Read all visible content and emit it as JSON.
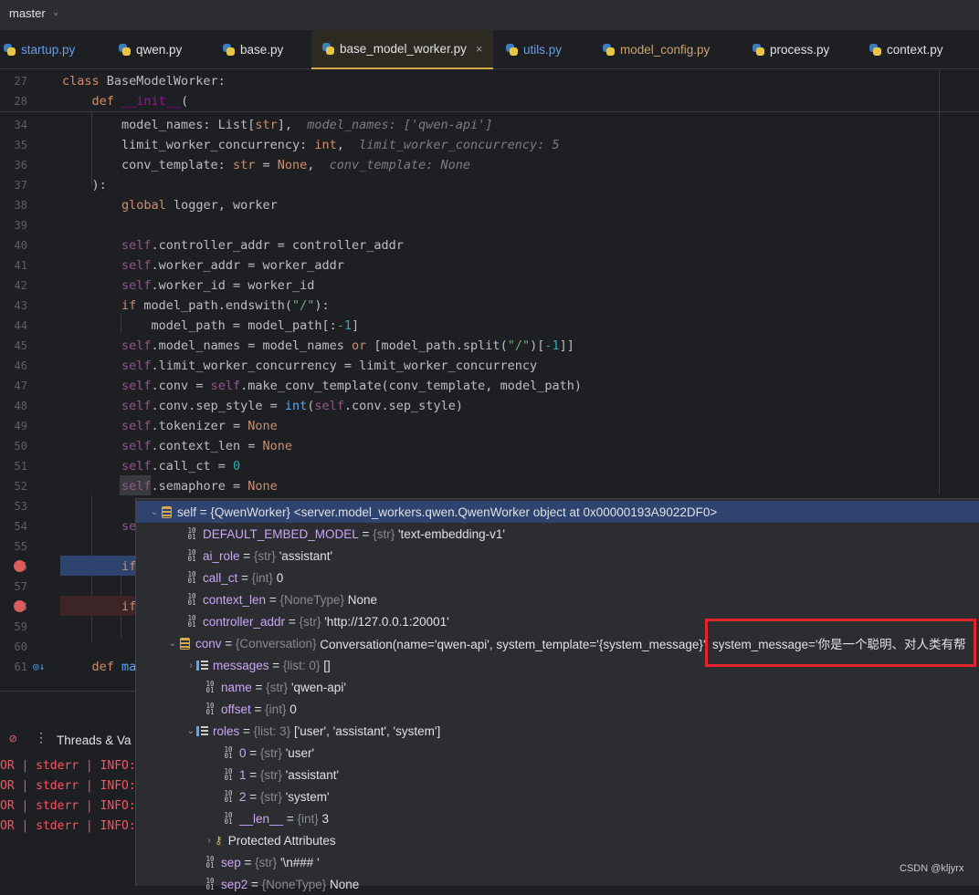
{
  "topbar": {
    "branch": "master"
  },
  "tabs": [
    {
      "label": "startup.py",
      "style": "blue"
    },
    {
      "label": "qwen.py",
      "style": "plain"
    },
    {
      "label": "base.py",
      "style": "plain"
    },
    {
      "label": "base_model_worker.py",
      "style": "active",
      "close": "×"
    },
    {
      "label": "utils.py",
      "style": "blue"
    },
    {
      "label": "model_config.py",
      "style": "orange"
    },
    {
      "label": "process.py",
      "style": "plain"
    },
    {
      "label": "context.py",
      "style": "plain"
    }
  ],
  "editor": {
    "line_numbers": [
      "27",
      "28",
      "34",
      "35",
      "36",
      "37",
      "38",
      "39",
      "40",
      "41",
      "42",
      "43",
      "44",
      "45",
      "46",
      "47",
      "48",
      "49",
      "50",
      "51",
      "52",
      "53",
      "54",
      "55",
      "56",
      "57",
      "58",
      "59",
      "60",
      "61"
    ],
    "breakpoints": [
      "56",
      "58"
    ],
    "hints": {
      "model_names": "model_names: ['qwen-api']",
      "limit_worker_concurrency": "limit_worker_concurrency: 5",
      "conv_template": "conv_template: None"
    }
  },
  "debug": {
    "threads_label": "Threads & Va",
    "console_lines": [
      "OR | stderr | INFO:",
      "OR | stderr | INFO:",
      "OR | stderr | INFO:",
      "OR | stderr | INFO:"
    ]
  },
  "variables": {
    "self": {
      "name": "self",
      "type": "{QwenWorker}",
      "value": "<server.model_workers.qwen.QwenWorker object at 0x00000193A9022DF0>"
    },
    "rows": [
      {
        "name": "DEFAULT_EMBED_MODEL",
        "type": "{str}",
        "value": "'text-embedding-v1'"
      },
      {
        "name": "ai_role",
        "type": "{str}",
        "value": "'assistant'"
      },
      {
        "name": "call_ct",
        "type": "{int}",
        "value": "0"
      },
      {
        "name": "context_len",
        "type": "{NoneType}",
        "value": "None"
      },
      {
        "name": "controller_addr",
        "type": "{str}",
        "value": "'http://127.0.0.1:20001'"
      }
    ],
    "conv": {
      "name": "conv",
      "type": "{Conversation}",
      "value": "Conversation(name='qwen-api', system_template='{system_message}', system_message='你是一个聪明、对人类有帮"
    },
    "conv_children": [
      {
        "name": "messages",
        "type": "{list: 0}",
        "value": "[]"
      },
      {
        "name": "name",
        "type": "{str}",
        "value": "'qwen-api'"
      },
      {
        "name": "offset",
        "type": "{int}",
        "value": "0"
      }
    ],
    "roles": {
      "name": "roles",
      "type": "{list: 3}",
      "value": "['user', 'assistant', 'system']"
    },
    "roles_children": [
      {
        "name": "0",
        "type": "{str}",
        "value": "'user'"
      },
      {
        "name": "1",
        "type": "{str}",
        "value": "'assistant'"
      },
      {
        "name": "2",
        "type": "{str}",
        "value": "'system'"
      },
      {
        "name": "__len__",
        "type": "{int}",
        "value": "3"
      }
    ],
    "protected": "Protected Attributes",
    "sep": {
      "name": "sep",
      "type": "{str}",
      "value": "'\\n### '"
    },
    "sep2": {
      "name": "sep2",
      "type": "{NoneType}",
      "value": "None"
    }
  },
  "watermark": "CSDN @kljyrx",
  "colors": {
    "accent_tab": "#d6a94a",
    "selection": "#2e436e",
    "highlight_box": "#e5232b",
    "breakpoint": "#db5c5c"
  }
}
